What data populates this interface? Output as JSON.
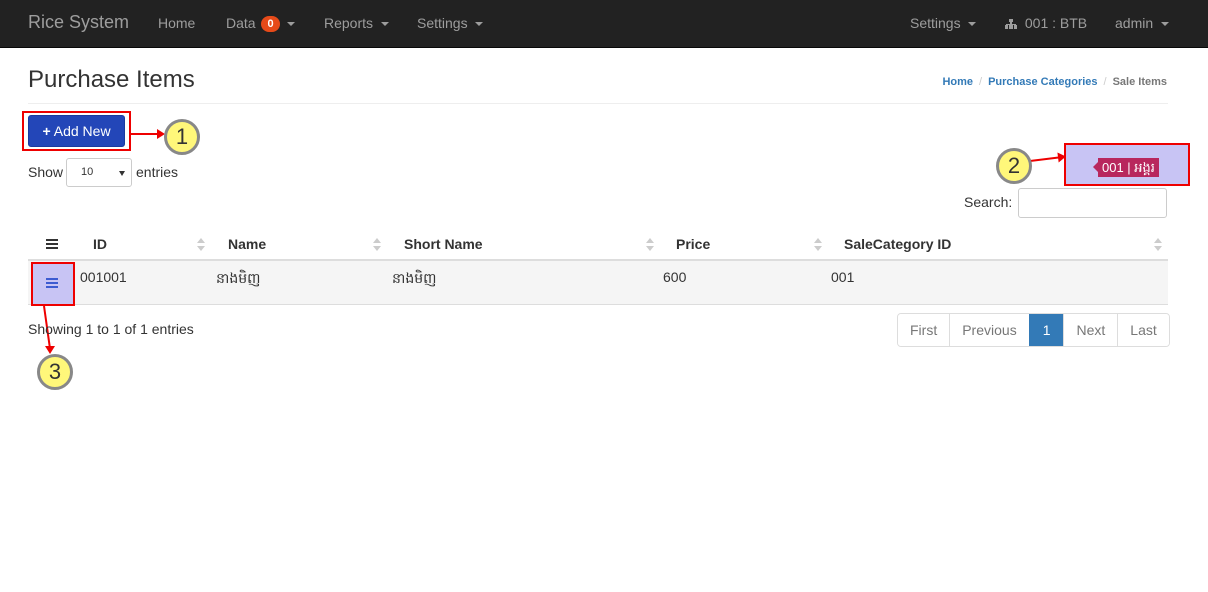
{
  "navbar": {
    "brand": "Rice System",
    "items": [
      {
        "label": "Home"
      },
      {
        "label": "Data",
        "badge": "0"
      },
      {
        "label": "Reports"
      },
      {
        "label": "Settings"
      }
    ],
    "right": {
      "settings_label": "Settings",
      "branch_label": "001 : BTB",
      "user_label": "admin"
    }
  },
  "header": {
    "title": "Purchase Items",
    "breadcrumb": [
      "Home",
      "Purchase Categories",
      "Sale Items"
    ]
  },
  "toolbar": {
    "add_new_label": "Add New"
  },
  "length_control": {
    "show_label": "Show",
    "selected": "10",
    "entries_label": "entries"
  },
  "company_badge": "001 | អង្គរ",
  "search": {
    "label": "Search:",
    "value": ""
  },
  "table": {
    "columns": [
      "ID",
      "Name",
      "Short Name",
      "Price",
      "SaleCategory ID"
    ],
    "rows": [
      {
        "id": "001001",
        "name": "នាងមិញ",
        "short_name": "នាងមិញ",
        "price": "600",
        "sale_category_id": "001"
      }
    ]
  },
  "footer": {
    "info": "Showing 1 to 1 of 1 entries",
    "pagination": [
      "First",
      "Previous",
      "1",
      "Next",
      "Last"
    ],
    "active_page": "1"
  },
  "annotations": [
    "1",
    "2",
    "3"
  ],
  "colors": {
    "navbar_bg": "#222222",
    "primary": "#2346b8",
    "link": "#337ab7",
    "badge": "#e64a19",
    "company_badge": "#b8275d",
    "annotation_border": "#ee0000",
    "callout_fill": "#fff77a"
  }
}
